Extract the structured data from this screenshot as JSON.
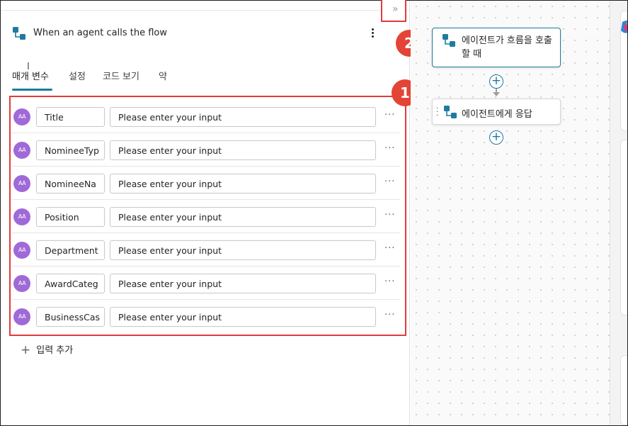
{
  "panel": {
    "title": "When an agent calls the flow",
    "tabs": [
      {
        "label": "매개 변수",
        "active": true
      },
      {
        "label": "설정",
        "active": false
      },
      {
        "label": "코드 보기",
        "active": false
      },
      {
        "label": "약",
        "active": false
      }
    ],
    "parameters": [
      {
        "avatar": "AA",
        "name": "Title",
        "placeholder": "Please enter your input"
      },
      {
        "avatar": "AA",
        "name": "NomineeTyp",
        "placeholder": "Please enter your input"
      },
      {
        "avatar": "AA",
        "name": "NomineeNa",
        "placeholder": "Please enter your input"
      },
      {
        "avatar": "AA",
        "name": "Position",
        "placeholder": "Please enter your input"
      },
      {
        "avatar": "AA",
        "name": "Department",
        "placeholder": "Please enter your input"
      },
      {
        "avatar": "AA",
        "name": "AwardCateg",
        "placeholder": "Please enter your input"
      },
      {
        "avatar": "AA",
        "name": "BusinessCas",
        "placeholder": "Please enter your input"
      }
    ],
    "more_label": "···",
    "add_input_label": "입력 추가",
    "collapse_icon": "chevron-double-right-icon"
  },
  "annotations": {
    "badge1": "1",
    "badge2": "2"
  },
  "canvas": {
    "nodes": [
      {
        "label": "에이전트가 흐름을 호출할 때",
        "icon": "flow-trigger-icon"
      },
      {
        "label": "에이전트에게 응답",
        "icon": "flow-trigger-icon"
      }
    ]
  },
  "colors": {
    "accent": "#1f7aa0",
    "highlight_red": "#e03b3b",
    "badge_red": "#e34435",
    "avatar_purple": "#9f6ad7"
  }
}
